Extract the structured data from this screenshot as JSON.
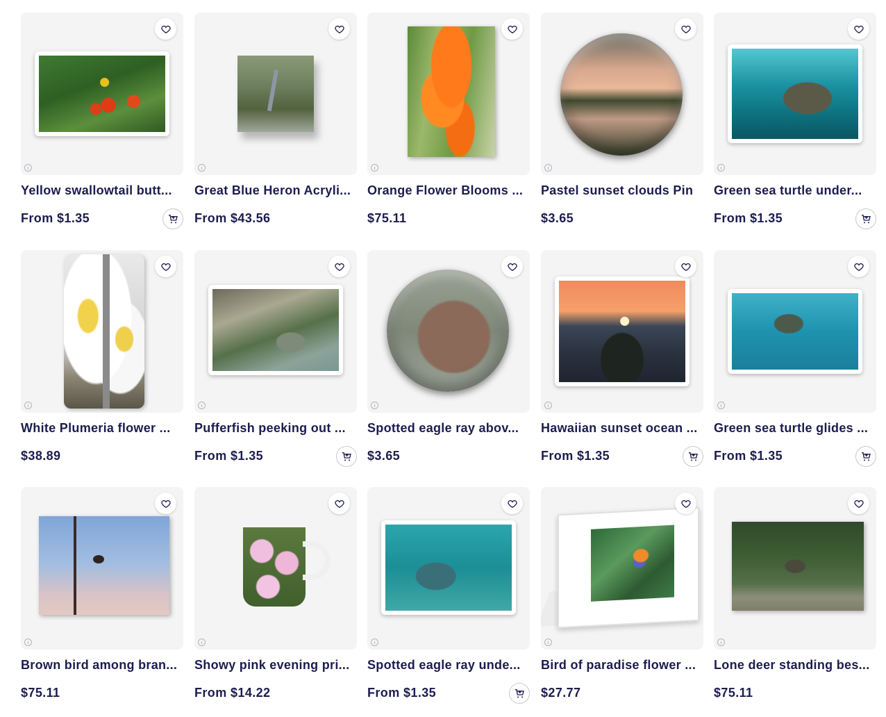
{
  "products": [
    {
      "title": "Yellow swallowtail butt...",
      "price": "From $1.35",
      "has_cart": true
    },
    {
      "title": "Great Blue Heron Acryli...",
      "price": "From $43.56",
      "has_cart": false
    },
    {
      "title": "Orange Flower Blooms ...",
      "price": "$75.11",
      "has_cart": false
    },
    {
      "title": "Pastel sunset clouds Pin",
      "price": "$3.65",
      "has_cart": false
    },
    {
      "title": "Green sea turtle under...",
      "price": "From $1.35",
      "has_cart": true
    },
    {
      "title": "White Plumeria flower ...",
      "price": "$38.89",
      "has_cart": false
    },
    {
      "title": "Pufferfish peeking out ...",
      "price": "From $1.35",
      "has_cart": true
    },
    {
      "title": "Spotted eagle ray abov...",
      "price": "$3.65",
      "has_cart": false
    },
    {
      "title": "Hawaiian sunset ocean ...",
      "price": "From $1.35",
      "has_cart": true
    },
    {
      "title": "Green sea turtle glides ...",
      "price": "From $1.35",
      "has_cart": true
    },
    {
      "title": "Brown bird among bran...",
      "price": "$75.11",
      "has_cart": false
    },
    {
      "title": "Showy pink evening pri...",
      "price": "From $14.22",
      "has_cart": false
    },
    {
      "title": "Spotted eagle ray unde...",
      "price": "From $1.35",
      "has_cart": true
    },
    {
      "title": "Bird of paradise flower ...",
      "price": "$27.77",
      "has_cart": false
    },
    {
      "title": "Lone deer standing bes...",
      "price": "$75.11",
      "has_cart": false
    }
  ],
  "icons": {
    "favorite": "heart-icon",
    "cart": "cart-plus-icon",
    "info": "info-icon"
  },
  "colors": {
    "text": "#1c1c4f",
    "thumb_bg": "#f4f4f5"
  }
}
